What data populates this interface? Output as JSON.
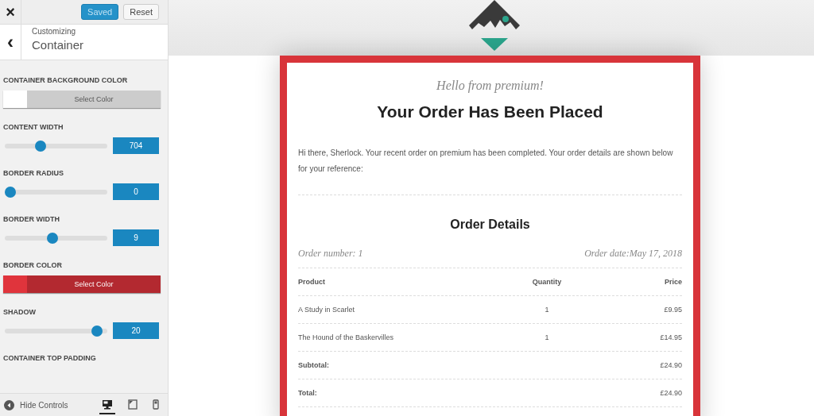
{
  "toolbar": {
    "save_label": "Saved",
    "reset_label": "Reset",
    "close_icon": "×"
  },
  "header": {
    "back_icon": "‹",
    "subtitle": "Customizing",
    "title": "Container"
  },
  "controls": [
    {
      "kind": "color",
      "label": "CONTAINER BACKGROUND COLOR",
      "button": "Select Color",
      "color": "#ffffff"
    },
    {
      "kind": "slider",
      "label": "CONTENT WIDTH",
      "level": 0.33,
      "value": "704"
    },
    {
      "kind": "slider",
      "label": "BORDER RADIUS",
      "level": 0,
      "value": "0"
    },
    {
      "kind": "slider",
      "label": "BORDER WIDTH",
      "level": 0.46,
      "value": "9"
    },
    {
      "kind": "color",
      "label": "BORDER COLOR",
      "button": "Select Color",
      "color": "#e0343c"
    },
    {
      "kind": "slider",
      "label": "SHADOW",
      "level": 0.95,
      "value": "20"
    },
    {
      "kind": "heading",
      "label": "CONTAINER TOP PADDING"
    }
  ],
  "footer": {
    "hide_label": "Hide Controls",
    "devices": [
      {
        "kind": "desktop",
        "selected": true
      },
      {
        "kind": "tablet",
        "selected": false
      },
      {
        "kind": "mobile",
        "selected": false
      }
    ]
  },
  "email": {
    "greeting": "Hello from premium!",
    "title": "Your Order Has Been Placed",
    "intro": "Hi there, Sherlock. Your recent order on premium has been completed. Your order details are shown below for your reference:",
    "details_title": "Order Details",
    "order_number": "Order number: 1",
    "order_date": "Order date:May 17, 2018",
    "columns": [
      "Product",
      "Quantity",
      "Price"
    ],
    "rows": [
      [
        "A Study in Scarlet",
        "1",
        "£9.95"
      ],
      [
        "The Hound of the Baskervilles",
        "1",
        "£14.95"
      ]
    ],
    "totals": [
      {
        "label": "Subtotal:",
        "value": "£24.90"
      },
      {
        "label": "Total:",
        "value": "£24.90"
      }
    ]
  }
}
